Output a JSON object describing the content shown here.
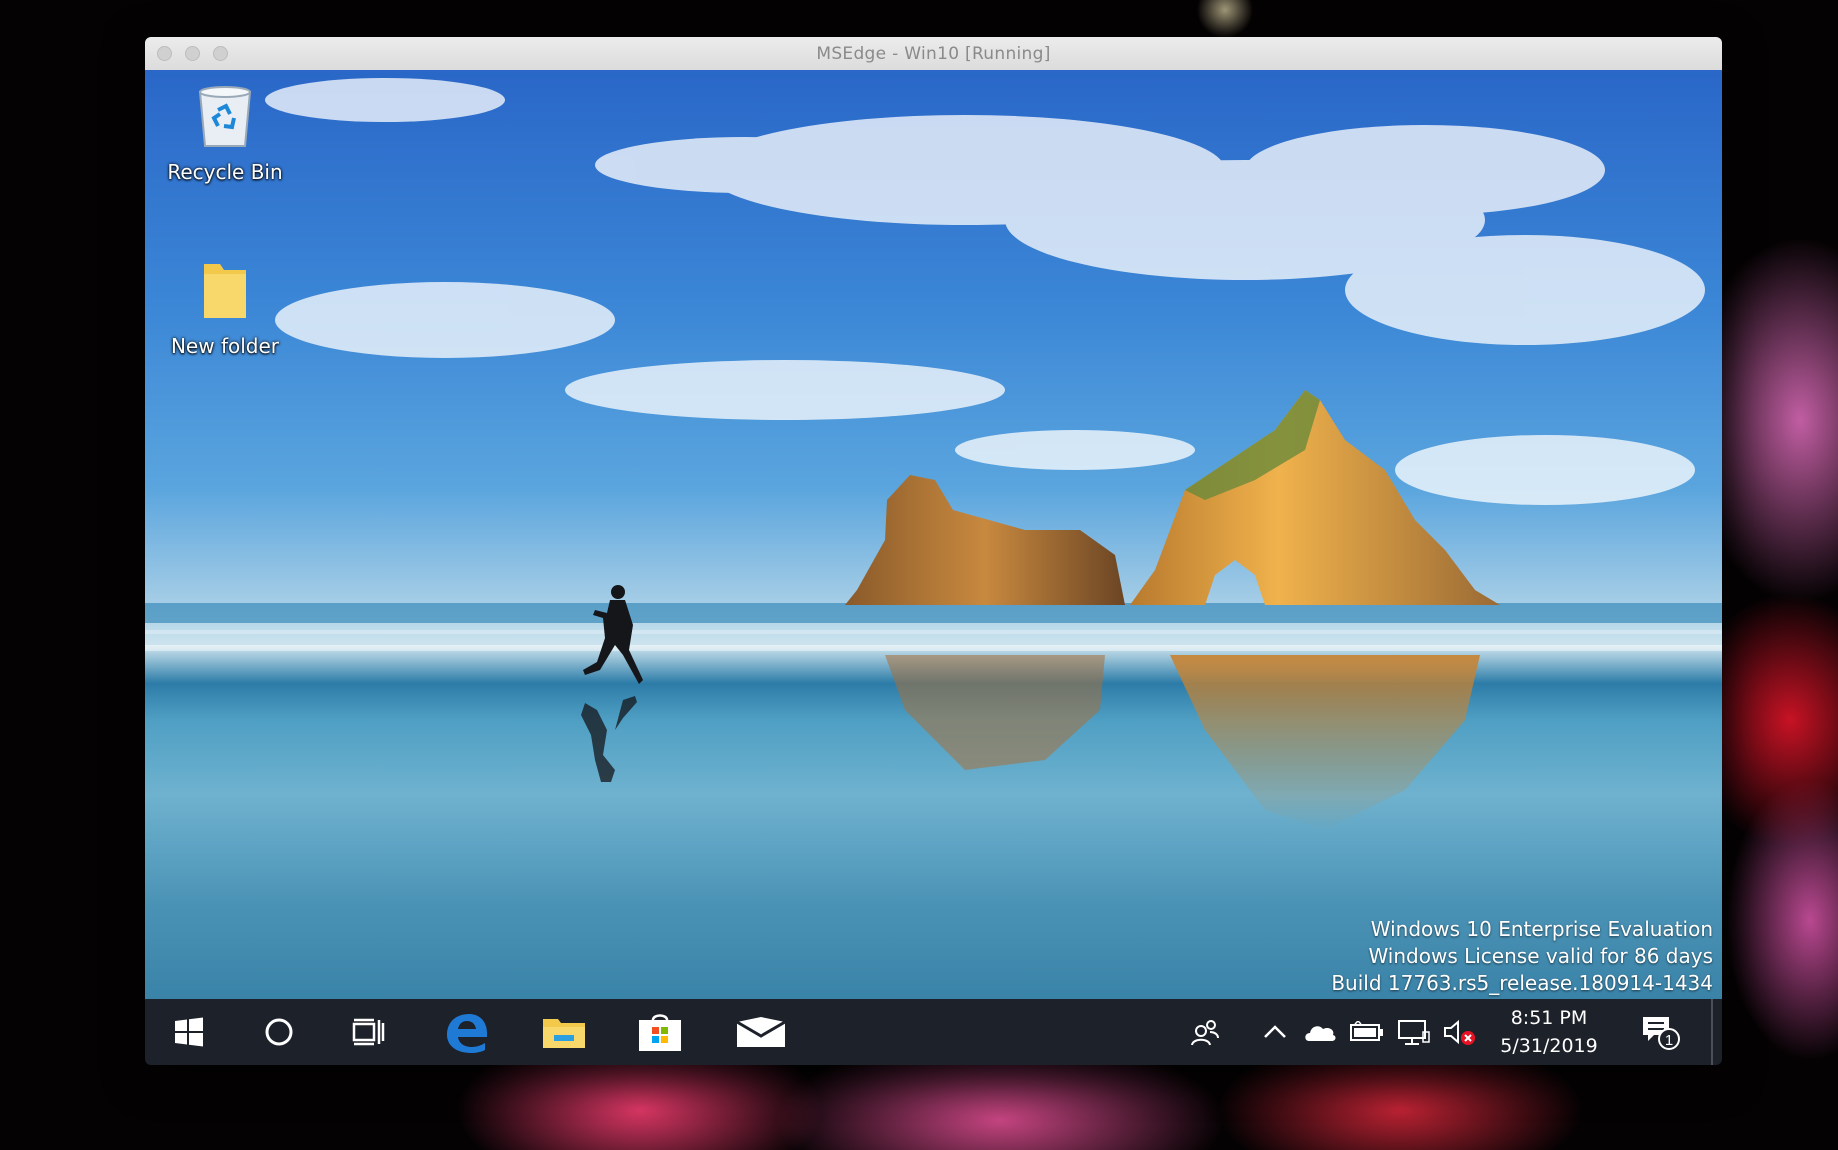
{
  "window": {
    "title": "MSEdge - Win10 [Running]"
  },
  "desktop": {
    "icons": [
      {
        "label": "Recycle Bin",
        "icon": "recycle-bin-icon"
      },
      {
        "label": "New folder",
        "icon": "folder-icon"
      }
    ],
    "watermark": {
      "line1": "Windows 10 Enterprise Evaluation",
      "line2": "Windows License valid for 86 days",
      "line3": "Build 17763.rs5_release.180914-1434"
    }
  },
  "taskbar": {
    "pinned": [
      {
        "name": "start",
        "icon": "windows-logo-icon"
      },
      {
        "name": "cortana",
        "icon": "circle-search-icon"
      },
      {
        "name": "task-view",
        "icon": "task-view-icon"
      },
      {
        "name": "edge",
        "icon": "edge-icon"
      },
      {
        "name": "file-explorer",
        "icon": "file-explorer-icon"
      },
      {
        "name": "store",
        "icon": "store-icon"
      },
      {
        "name": "mail",
        "icon": "mail-icon"
      }
    ],
    "tray": {
      "icons": [
        "people-icon",
        "chevron-up-icon",
        "onedrive-icon",
        "battery-icon",
        "network-icon",
        "volume-muted-icon"
      ],
      "time": "8:51 PM",
      "date": "5/31/2019",
      "notification_count": "1"
    }
  },
  "colors": {
    "taskbar": "#1d2129",
    "edge_blue": "#1f7ad6",
    "folder_yellow": "#f3c94c"
  }
}
